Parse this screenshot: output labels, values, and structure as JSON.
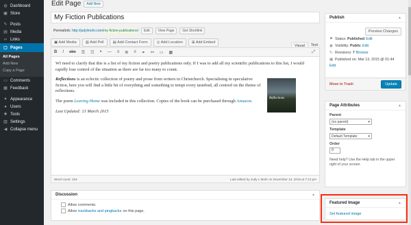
{
  "sidebar": {
    "items": [
      {
        "label": "Dashboard",
        "icon": "dashboard-icon",
        "glyph": "◍"
      },
      {
        "label": "Store",
        "icon": "store-icon",
        "glyph": "▣"
      },
      {
        "label": "Posts",
        "icon": "pin-icon",
        "glyph": "✎"
      },
      {
        "label": "Media",
        "icon": "media-icon",
        "glyph": "▤"
      },
      {
        "label": "Links",
        "icon": "link-icon",
        "glyph": "∞"
      },
      {
        "label": "Pages",
        "icon": "pages-icon",
        "glyph": "▢"
      }
    ],
    "submenu": [
      "All Pages",
      "Add New",
      "Copy a Page"
    ],
    "items2": [
      {
        "label": "Comments",
        "icon": "comments-icon",
        "glyph": "▭"
      },
      {
        "label": "Feedback",
        "icon": "feedback-icon",
        "glyph": "▦"
      },
      {
        "label": "Appearance",
        "icon": "appearance-icon",
        "glyph": "✦"
      },
      {
        "label": "Users",
        "icon": "users-icon",
        "glyph": "●"
      },
      {
        "label": "Tools",
        "icon": "tools-icon",
        "glyph": "✚"
      },
      {
        "label": "Settings",
        "icon": "settings-icon",
        "glyph": "▥"
      },
      {
        "label": "Collapse menu",
        "icon": "collapse-icon",
        "glyph": "◀"
      }
    ]
  },
  "header": {
    "title": "Edit Page",
    "add_new": "Add New"
  },
  "post": {
    "title": "My Fiction Publications",
    "permalink_label": "Permalink:",
    "permalink_base": "http://judylmohr.com/",
    "permalink_slug": "my-fiction-publications",
    "permalink_end": "/",
    "edit_btn": "Edit",
    "view_btn": "View Page",
    "shortlink_btn": "Get Shortlink"
  },
  "toolbar": {
    "add_media": "Add Media",
    "add_poll": "Add Poll",
    "add_contact": "Add Contact Form",
    "add_location": "Add Location",
    "add_embed": "Add Embed",
    "tab_visual": "Visual",
    "tab_text": "Text"
  },
  "content": {
    "p1": "WI need to clarify that this is a list of my fiction and poetry publications only. If I was to add all my scientific publications to this list, I would rapidly lose control of the situation as there are far too many to count.",
    "p2_bold": "Reflections",
    "p2_rest": " is an eclectic collection of poetry and prose from writers in Christchurch. Specialising in speculative fiction, here you will find a little bit of everything and something to tempt every tastebud, all centred on the theme of reflections.",
    "p3_a": "The poem ",
    "p3_link": "Leaving Home",
    "p3_b": " was included in this collection. Copies of the book can be purchased through ",
    "p3_link2": "Amazon",
    "p3_c": ".",
    "p4": "Last Updated: 13 March 2015",
    "cover_text": "Reflections",
    "word_count": "Word count: 104",
    "last_edited": "Last edited by Judy L Mohr on November 13, 2015 at 7:13 pm"
  },
  "discussion": {
    "title": "Discussion",
    "allow_comments": "Allow comments.",
    "allow_a": "Allow ",
    "trackbacks": "trackbacks and pingbacks",
    "allow_b": " on this page."
  },
  "publish": {
    "title": "Publish",
    "preview": "Preview Changes",
    "status_label": "Status:",
    "status_value": "Published",
    "visibility_label": "Visibility:",
    "visibility_value": "Public",
    "revisions_label": "Revisions:",
    "revisions_value": "7",
    "browse": "Browse",
    "published_on": "Published on: Mar 13, 2015 @ 01:44",
    "edit": "Edit",
    "trash": "Move to Trash",
    "update": "Update"
  },
  "attributes": {
    "title": "Page Attributes",
    "parent_label": "Parent",
    "parent_value": "(no parent)",
    "template_label": "Template",
    "template_value": "Default Template",
    "order_label": "Order",
    "order_value": "0",
    "help": "Need help? Use the Help tab in the upper right of your screen."
  },
  "featured": {
    "title": "Featured Image",
    "link": "Set featured image"
  },
  "colors": {
    "accent": "#0073aa",
    "highlight_box": "#ff2a0e",
    "sidebar_bg": "#23282d"
  }
}
